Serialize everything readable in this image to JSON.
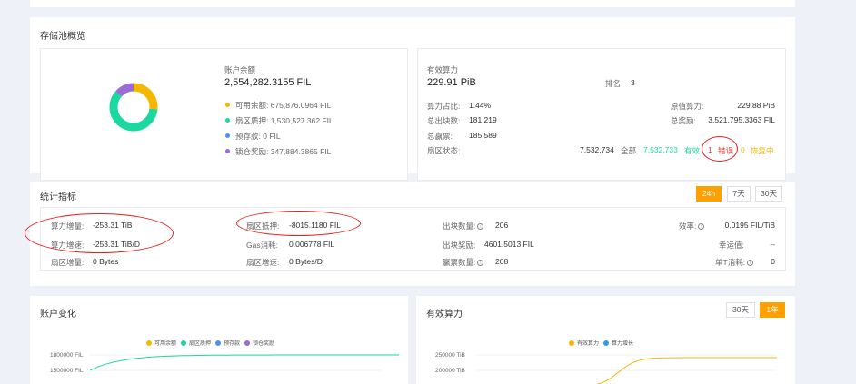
{
  "pool": {
    "title": "存储池概览",
    "balance_label": "账户余额",
    "balance_value": "2,554,282.3155 FIL",
    "donut": [
      {
        "name": "可用余额",
        "value": 675876.0964,
        "color": "#f5b800"
      },
      {
        "name": "扇区质押",
        "value": 1530527.362,
        "color": "#1dd7a1"
      },
      {
        "name": "预存款",
        "value": 0,
        "color": "#4f8ff7"
      },
      {
        "name": "锁仓奖励",
        "value": 347884.3865,
        "color": "#9b6bd6"
      }
    ],
    "legend": [
      "可用余额: 675,876.0964 FIL",
      "扇区质押: 1,530,527.362 FIL",
      "预存款: 0 FIL",
      "锁仓奖励: 347,884.3865 FIL"
    ]
  },
  "power": {
    "label": "有效算力",
    "value": "229.91 PiB",
    "rank_label": "排名",
    "rank_value": "3",
    "ratio_label": "算力占比:",
    "ratio_value": "1.44%",
    "raw_label": "原值算力:",
    "raw_value": "229.88 PiB",
    "blocks_label": "总出块数:",
    "blocks_value": "181,219",
    "reward_label": "总奖励:",
    "reward_value": "3,521,795.3363 FIL",
    "tickets_label": "总赢票:",
    "tickets_value": "185,589",
    "sector_label": "扇区状态:",
    "sector_total_value": "7,532,734",
    "sector_total_label": "全部",
    "sector_valid_value": "7,532,733",
    "sector_valid_label": "有效",
    "sector_error_value": "1",
    "sector_error_label": "错误",
    "sector_recover_value": "0",
    "sector_recover_label": "恢复中"
  },
  "stats": {
    "title": "统计指标",
    "tabs": [
      "24h",
      "7天",
      "30天"
    ],
    "active_tab": "24h",
    "col1": [
      {
        "label": "算力增量:",
        "value": "-253.31 TiB"
      },
      {
        "label": "算力增速:",
        "value": "-253.31 TiB/D"
      },
      {
        "label": "扇区增量:",
        "value": "0 Bytes"
      }
    ],
    "col2": [
      {
        "label": "扇区抵押:",
        "value": "-8015.1180 FIL"
      },
      {
        "label": "Gas消耗:",
        "value": "0.006778 FIL"
      },
      {
        "label": "扇区增速:",
        "value": "0 Bytes/D"
      }
    ],
    "col3": [
      {
        "label": "出块数量:",
        "value": "206"
      },
      {
        "label": "出块奖励:",
        "value": "4601.5013 FIL"
      },
      {
        "label": "赢票数量:",
        "value": "208"
      }
    ],
    "col4": [
      {
        "label": "效率:",
        "value": "0.0195 FIL/TiB"
      },
      {
        "label": "幸运值:",
        "value": "--"
      },
      {
        "label": "单T消耗:",
        "value": "0"
      }
    ]
  },
  "account_chart": {
    "title": "账户变化",
    "legend": [
      "可用余额",
      "扇区质押",
      "预存款",
      "锁仓奖励"
    ],
    "legend_colors": [
      "#f5b800",
      "#1dd7a1",
      "#4f8ff7",
      "#9b6bd6"
    ],
    "y_ticks": [
      "1800000 FIL",
      "1500000 FIL"
    ]
  },
  "power_chart": {
    "title": "有效算力",
    "tabs": [
      "30天",
      "1年"
    ],
    "active_tab": "1年",
    "legend": [
      "有效算力",
      "算力增长"
    ],
    "legend_colors": [
      "#f5b800",
      "#2d9cf0"
    ],
    "y_ticks": [
      "250000 TiB",
      "200000 TiB"
    ]
  }
}
